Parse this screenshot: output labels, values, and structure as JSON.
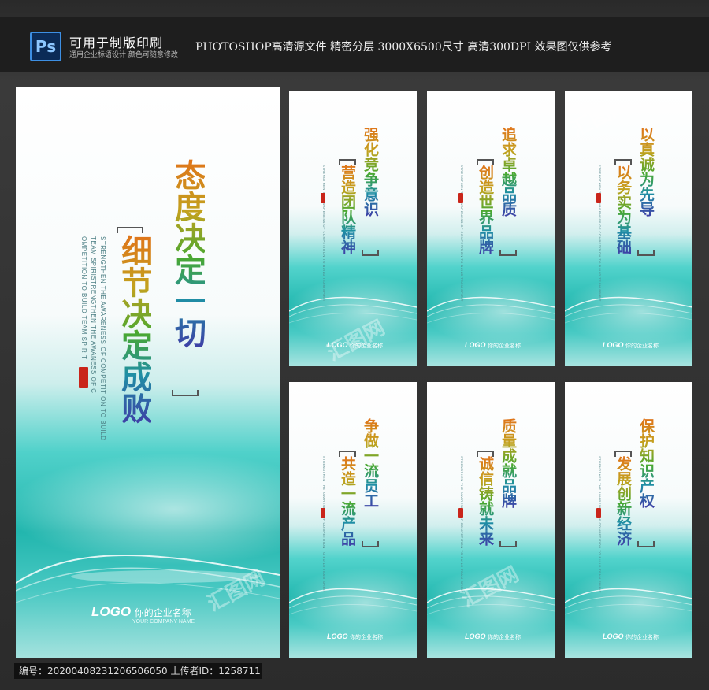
{
  "header": {
    "ps_icon": "Ps",
    "title": "可用于制版印刷",
    "subtitle": "通用企业标语设计  颜色可随意修改",
    "info": "PHOTOSHOP高清源文件  精密分层  3000X6500尺寸  高清300DPI  效果图仅供参考"
  },
  "main_poster": {
    "line1": "态度决定一切",
    "line2": "细节决定成败",
    "english": [
      "STRENGTHEN THE AWARENESS OF COMPETITION TO BUILD",
      "TEAM SPIRISTRENGTHEN THE AWANESS OF C",
      "OMPETITION TO BUILD TEAM SPIRIT"
    ],
    "logo": "LOGO",
    "company": "你的企业名称",
    "company_en": "YOUR COMPANY NAME"
  },
  "posters": [
    {
      "line1": "强化竞争意识",
      "line2": "营造团队精神"
    },
    {
      "line1": "追求卓越品质",
      "line2": "创造世界品牌"
    },
    {
      "line1": "以真诚为先导",
      "line2": "以务实为基础"
    },
    {
      "line1": "争做一流员工",
      "line2": "共造一流产品"
    },
    {
      "line1": "质量成就品牌",
      "line2": "诚信铸就未来"
    },
    {
      "line1": "保护知识产权",
      "line2": "发展创新经济"
    }
  ],
  "small_english": "STRENGTHEN THE AWARENESS OF COMPETITION TO BUILD TEAM SPIRIT",
  "small_logo": "LOGO",
  "small_company": "你的企业名称",
  "watermark": "汇图网",
  "footer": "编号：20200408231206506050 上传者ID：1258711",
  "colors": {
    "teal": "#23b8b0",
    "title_gradient": [
      "#e0741a",
      "#4aa830",
      "#3e3ea6"
    ],
    "seal": "#c9251a"
  }
}
